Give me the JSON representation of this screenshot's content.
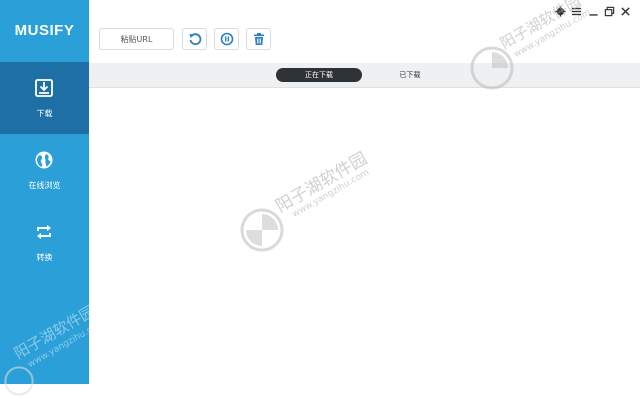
{
  "app": {
    "title": "MUSIFY"
  },
  "sidebar": {
    "items": [
      {
        "label": "下载",
        "icon": "download-icon",
        "active": true
      },
      {
        "label": "在线浏览",
        "icon": "globe-icon",
        "active": false
      },
      {
        "label": "转换",
        "icon": "convert-icon",
        "active": false
      }
    ]
  },
  "toolbar": {
    "paste_url_label": "粘贴URL",
    "buttons": [
      "refresh-icon",
      "pause-icon",
      "trash-icon"
    ]
  },
  "window_controls": [
    "gear-icon",
    "menu-icon",
    "minimize-icon",
    "restore-icon",
    "close-icon"
  ],
  "tabs": [
    {
      "label": "正在下载",
      "active": true
    },
    {
      "label": "已下载",
      "active": false
    }
  ],
  "watermark": {
    "text": "阳子湖软件园",
    "url": "www.yangzihu.com"
  },
  "colors": {
    "sidebar": "#2a9fd8",
    "sidebar_active": "#1d6fa5",
    "icon_accent": "#2a7fc0",
    "tab_active": "#2e3338"
  }
}
